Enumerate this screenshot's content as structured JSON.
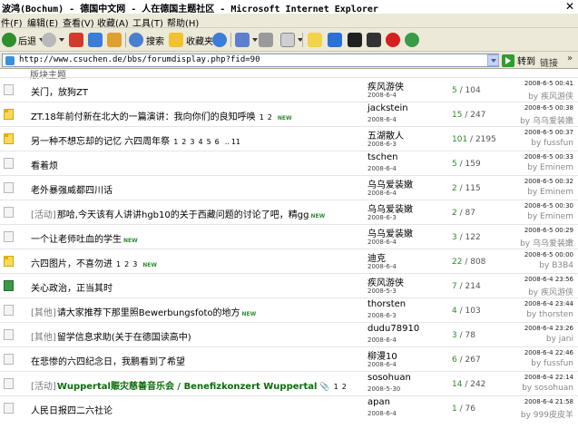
{
  "window": {
    "title": "波鸿(Bochum) - 德国中文网 - 人在德国主题社区 - Microsoft Internet Explorer",
    "close_glyph": "✕"
  },
  "menu": [
    {
      "label": "件(F)"
    },
    {
      "label": "编辑(E)"
    },
    {
      "label": "查看(V)"
    },
    {
      "label": "收藏(A)"
    },
    {
      "label": "工具(T)"
    },
    {
      "label": "帮助(H)"
    }
  ],
  "toolbar": {
    "back_label": "后退",
    "search_label": "搜索",
    "favorites_label": "收藏夹",
    "colors": {
      "back": "#2f8f2f",
      "forward": "#9a9a9a",
      "stop": "#d23b2b",
      "refresh": "#3b7dd8",
      "home": "#e0a030",
      "search": "#4a7fd0",
      "favorites": "#f2c12e",
      "history": "#3b7dd8",
      "mail": "#5c7fcf",
      "print": "#9a9a9a",
      "word": "#cfcfcf",
      "folder": "#f2d34a",
      "qq": "#2b6fd8",
      "k": "#202020",
      "edit": "#333333",
      "stop2": "#d61f1f",
      "messenger": "#3a9a48"
    }
  },
  "address": {
    "url": "http://www.csuchen.de/bbs/forumdisplay.php?fid=90",
    "go_label": "转到",
    "links_label": "链接",
    "more_glyph": "»"
  },
  "content": {
    "section_title": "版块主题",
    "threads": [
      {
        "icon": "plain",
        "category": "",
        "subject": "关门，放狗ZT",
        "green": false,
        "pages": [],
        "ellipsis_after": null,
        "last_page": null,
        "is_new": false,
        "clip": false,
        "author": "疾风游侠",
        "date": "2008-6-4",
        "replies": "5",
        "views": "104",
        "last_time": "2008-6-5 00:41",
        "last_by": "by 疾风游侠"
      },
      {
        "icon": "hot",
        "category": "",
        "subject": "ZT.18年前付新在北大的一篇演讲：我向你们的良知呼唤",
        "green": false,
        "pages": [
          "1",
          "2"
        ],
        "ellipsis_after": null,
        "last_page": null,
        "is_new": true,
        "clip": false,
        "author": "jackstein",
        "date": "2008-6-4",
        "replies": "15",
        "views": "247",
        "last_time": "2008-6-5 00:38",
        "last_by": "by 乌乌爱装嫩"
      },
      {
        "icon": "hot",
        "category": "",
        "subject": "另一种不想忘却的记忆 六四周年祭",
        "green": false,
        "pages": [
          "1",
          "2",
          "3",
          "4",
          "5",
          "6"
        ],
        "ellipsis_after": "..",
        "last_page": "11",
        "is_new": false,
        "clip": false,
        "author": "五湖散人",
        "date": "2008-6-3",
        "replies": "101",
        "views": "2195",
        "last_time": "2008-6-5 00:37",
        "last_by": "by fussfun"
      },
      {
        "icon": "plain",
        "category": "",
        "subject": "看着烦",
        "green": false,
        "pages": [],
        "ellipsis_after": null,
        "last_page": null,
        "is_new": false,
        "clip": false,
        "author": "tschen",
        "date": "2008-6-4",
        "replies": "5",
        "views": "159",
        "last_time": "2008-6-5 00:33",
        "last_by": "by Eminem"
      },
      {
        "icon": "plain",
        "category": "",
        "subject": "老外暴强威都四川话",
        "green": false,
        "pages": [],
        "ellipsis_after": null,
        "last_page": null,
        "is_new": false,
        "clip": false,
        "author": "乌乌爱装嫩",
        "date": "2008-6-4",
        "replies": "2",
        "views": "115",
        "last_time": "2008-6-5 00:32",
        "last_by": "by Eminem"
      },
      {
        "icon": "plain",
        "category": "[活动]",
        "subject": "那哈,今天该有人讲讲hgb10的关于西藏问题的讨论了吧，精gg",
        "green": false,
        "pages": [],
        "ellipsis_after": null,
        "last_page": null,
        "is_new": true,
        "clip": false,
        "author": "乌乌爱装嫩",
        "date": "2008-6-3",
        "replies": "2",
        "views": "87",
        "last_time": "2008-6-5 00:30",
        "last_by": "by Eminem"
      },
      {
        "icon": "plain",
        "category": "",
        "subject": "一个让老师吐血的学生",
        "green": false,
        "pages": [],
        "ellipsis_after": null,
        "last_page": null,
        "is_new": true,
        "clip": false,
        "author": "乌乌爱装嫩",
        "date": "2008-6-4",
        "replies": "3",
        "views": "122",
        "last_time": "2008-6-5 00:29",
        "last_by": "by 乌乌爱装嫩"
      },
      {
        "icon": "hot",
        "category": "",
        "subject": "六四图片，不喜勿进",
        "green": false,
        "pages": [
          "1",
          "2",
          "3"
        ],
        "ellipsis_after": null,
        "last_page": null,
        "is_new": true,
        "clip": false,
        "author": "迪克",
        "date": "2008-6-4",
        "replies": "22",
        "views": "808",
        "last_time": "2008-6-5 00:00",
        "last_by": "by B3B4"
      },
      {
        "icon": "special",
        "category": "",
        "subject": "关心政治，正当其时",
        "green": false,
        "pages": [],
        "ellipsis_after": null,
        "last_page": null,
        "is_new": false,
        "clip": false,
        "author": "疾风游侠",
        "date": "2008-5-3",
        "replies": "7",
        "views": "214",
        "last_time": "2008-6-4 23:56",
        "last_by": "by 疾风游侠"
      },
      {
        "icon": "plain",
        "category": "[其他]",
        "subject": "请大家推荐下那里照Bewerbungsfoto的地方",
        "green": false,
        "pages": [],
        "ellipsis_after": null,
        "last_page": null,
        "is_new": true,
        "clip": false,
        "author": "thorsten",
        "date": "2008-6-3",
        "replies": "4",
        "views": "103",
        "last_time": "2008-6-4 23:44",
        "last_by": "by thorsten"
      },
      {
        "icon": "plain",
        "category": "[其他]",
        "subject": "留学信息求助(关于在德国读高中)",
        "green": false,
        "pages": [],
        "ellipsis_after": null,
        "last_page": null,
        "is_new": false,
        "clip": false,
        "author": "dudu78910",
        "date": "2008-6-4",
        "replies": "3",
        "views": "78",
        "last_time": "2008-6-4 23:26",
        "last_by": "by jani"
      },
      {
        "icon": "plain",
        "category": "",
        "subject": "在悲惨的六四纪念日，我鹏看到了希望",
        "green": false,
        "pages": [],
        "ellipsis_after": null,
        "last_page": null,
        "is_new": false,
        "clip": false,
        "author": "柳漫10",
        "date": "2008-6-4",
        "replies": "6",
        "views": "267",
        "last_time": "2008-6-4 22:46",
        "last_by": "by fussfun"
      },
      {
        "icon": "plain",
        "category": "[活动]",
        "subject": "Wuppertal赈灾慈善音乐会 / Benefizkonzert Wuppertal",
        "green": true,
        "pages": [
          "1",
          "2"
        ],
        "ellipsis_after": null,
        "last_page": null,
        "is_new": false,
        "clip": true,
        "author": "sosohuan",
        "date": "2008-5-30",
        "replies": "14",
        "views": "242",
        "last_time": "2008-6-4 22:14",
        "last_by": "by sosohuan"
      },
      {
        "icon": "plain",
        "category": "",
        "subject": "人民日报四二六社论",
        "green": false,
        "pages": [],
        "ellipsis_after": null,
        "last_page": null,
        "is_new": false,
        "clip": false,
        "author": "apan",
        "date": "2008-6-4",
        "replies": "1",
        "views": "76",
        "last_time": "2008-6-4 21:58",
        "last_by": "by 999皮皮羊"
      }
    ],
    "new_tag": "NEW",
    "clip_glyph": "📎",
    "views_sep": " / "
  }
}
